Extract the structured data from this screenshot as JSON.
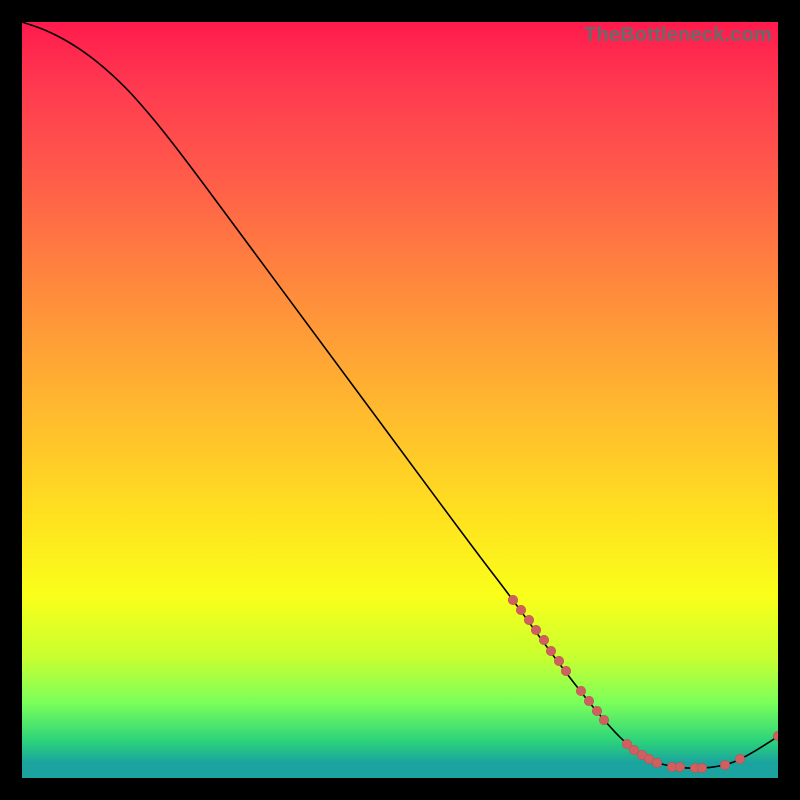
{
  "watermark": "TheBottleneck.com",
  "chart_data": {
    "type": "line",
    "title": "",
    "xlabel": "",
    "ylabel": "",
    "xlim": [
      0,
      100
    ],
    "ylim": [
      0,
      100
    ],
    "grid": false,
    "curve": [
      {
        "x": 0,
        "y": 100
      },
      {
        "x": 3,
        "y": 99
      },
      {
        "x": 6,
        "y": 97.5
      },
      {
        "x": 9,
        "y": 95.5
      },
      {
        "x": 12,
        "y": 93
      },
      {
        "x": 15,
        "y": 90
      },
      {
        "x": 20,
        "y": 84
      },
      {
        "x": 30,
        "y": 70.5
      },
      {
        "x": 40,
        "y": 57
      },
      {
        "x": 50,
        "y": 43.5
      },
      {
        "x": 60,
        "y": 30
      },
      {
        "x": 65,
        "y": 23.5
      },
      {
        "x": 70,
        "y": 16.5
      },
      {
        "x": 75,
        "y": 10
      },
      {
        "x": 78,
        "y": 6.5
      },
      {
        "x": 80,
        "y": 4.5
      },
      {
        "x": 82,
        "y": 3
      },
      {
        "x": 84,
        "y": 2
      },
      {
        "x": 86,
        "y": 1.5
      },
      {
        "x": 88,
        "y": 1.3
      },
      {
        "x": 90,
        "y": 1.3
      },
      {
        "x": 92,
        "y": 1.5
      },
      {
        "x": 94,
        "y": 2
      },
      {
        "x": 96,
        "y": 3
      },
      {
        "x": 98,
        "y": 4.2
      },
      {
        "x": 100,
        "y": 5.5
      }
    ],
    "markers": [
      {
        "x": 65.0,
        "y": 23.5
      },
      {
        "x": 66.0,
        "y": 22.2
      },
      {
        "x": 67.0,
        "y": 20.9
      },
      {
        "x": 68.0,
        "y": 19.6
      },
      {
        "x": 69.0,
        "y": 18.2
      },
      {
        "x": 70.0,
        "y": 16.8
      },
      {
        "x": 71.0,
        "y": 15.5
      },
      {
        "x": 72.0,
        "y": 14.2
      },
      {
        "x": 74.0,
        "y": 11.5
      },
      {
        "x": 75.0,
        "y": 10.2
      },
      {
        "x": 76.0,
        "y": 8.9
      },
      {
        "x": 77.0,
        "y": 7.7
      },
      {
        "x": 80.0,
        "y": 4.5
      },
      {
        "x": 81.0,
        "y": 3.7
      },
      {
        "x": 82.0,
        "y": 3.0
      },
      {
        "x": 83.0,
        "y": 2.5
      },
      {
        "x": 84.0,
        "y": 2.0
      },
      {
        "x": 86.0,
        "y": 1.5
      },
      {
        "x": 87.0,
        "y": 1.4
      },
      {
        "x": 89.0,
        "y": 1.3
      },
      {
        "x": 90.0,
        "y": 1.3
      },
      {
        "x": 93.0,
        "y": 1.7
      },
      {
        "x": 95.0,
        "y": 2.5
      },
      {
        "x": 100.0,
        "y": 5.5
      }
    ],
    "colors": {
      "line": "#000000",
      "marker": "#d06060"
    }
  }
}
